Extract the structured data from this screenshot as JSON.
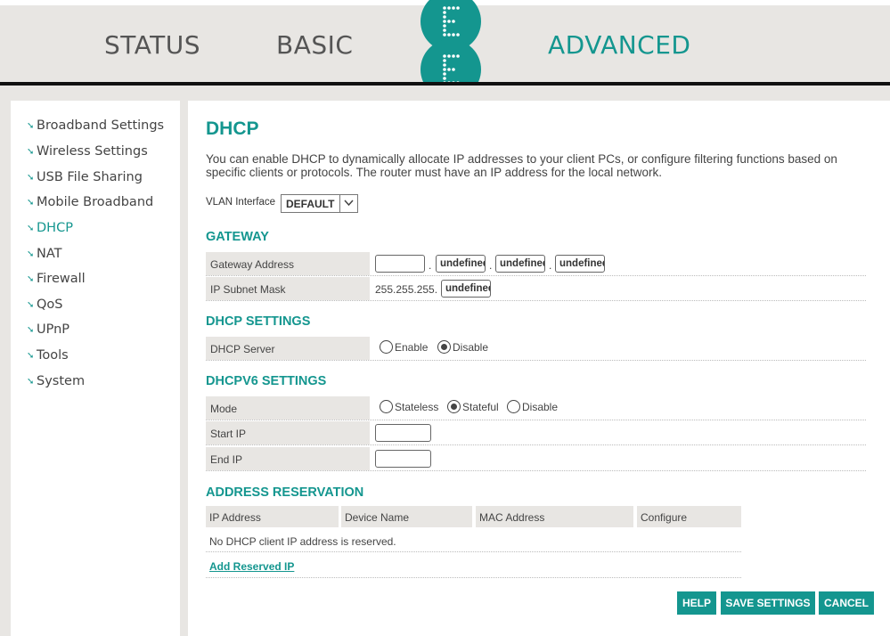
{
  "header": {
    "nav": {
      "status": "STATUS",
      "basic": "BASIC",
      "advanced": "ADVANCED"
    },
    "logo_letters": [
      "E",
      "E"
    ],
    "colors": {
      "accent": "#14968f",
      "band": "#e8e6e3"
    }
  },
  "sidebar": {
    "items": [
      {
        "label": "Broadband Settings"
      },
      {
        "label": "Wireless Settings"
      },
      {
        "label": "USB File Sharing"
      },
      {
        "label": "Mobile Broadband"
      },
      {
        "label": "DHCP",
        "active": true
      },
      {
        "label": "NAT"
      },
      {
        "label": "Firewall"
      },
      {
        "label": "QoS"
      },
      {
        "label": "UPnP"
      },
      {
        "label": "Tools"
      },
      {
        "label": "System"
      }
    ]
  },
  "main": {
    "title": "DHCP",
    "description": "You can enable DHCP to dynamically allocate IP addresses to your client PCs, or configure filtering functions based on specific clients or protocols. The router must have an IP address for the local network.",
    "vlan": {
      "label": "VLAN Interface",
      "value": "DEFAULT"
    },
    "gateway": {
      "heading": "GATEWAY",
      "address_label": "Gateway Address",
      "address_octets": [
        "",
        "undefined",
        "undefined",
        "undefined"
      ],
      "subnet_label": "IP Subnet Mask",
      "subnet_prefix": "255.255.255.",
      "subnet_last": "undefined"
    },
    "dhcp_settings": {
      "heading": "DHCP SETTINGS",
      "server_label": "DHCP Server",
      "options": [
        "Enable",
        "Disable"
      ],
      "selected": "Disable"
    },
    "dhcpv6": {
      "heading": "DHCPV6 SETTINGS",
      "mode_label": "Mode",
      "modes": [
        "Stateless",
        "Stateful",
        "Disable"
      ],
      "selected_mode": "Stateful",
      "start_label": "Start IP",
      "start_value": "",
      "end_label": "End IP",
      "end_value": ""
    },
    "reservation": {
      "heading": "ADDRESS RESERVATION",
      "columns": [
        "IP Address",
        "Device Name",
        "MAC Address",
        "Configure"
      ],
      "empty_message": "No DHCP client IP address is reserved.",
      "add_link": "Add Reserved IP"
    },
    "buttons": {
      "help": "HELP",
      "save": "SAVE SETTINGS",
      "cancel": "CANCEL"
    }
  }
}
